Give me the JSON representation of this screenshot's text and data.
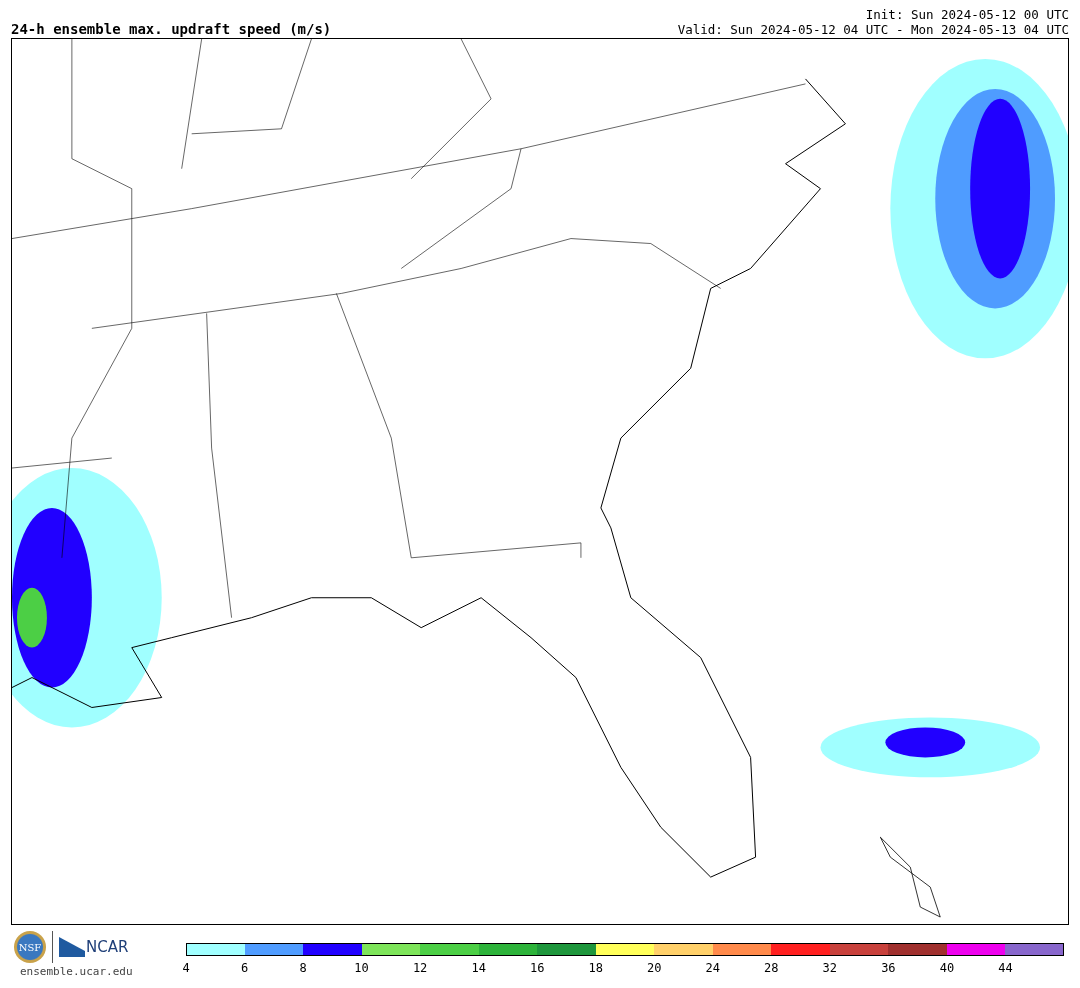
{
  "title": "24-h ensemble max. updraft speed (m/s)",
  "init": "Init: Sun 2024-05-12 00 UTC",
  "valid": "Valid: Sun 2024-05-12 04 UTC - Mon 2024-05-13 04 UTC",
  "logos": {
    "nsf": "NSF",
    "ncar": "NCAR"
  },
  "site": "ensemble.ucar.edu",
  "colorbar": [
    {
      "color": "#a0ffff",
      "label": "4"
    },
    {
      "color": "#4f9cff",
      "label": "6"
    },
    {
      "color": "#2100ff",
      "label": "8"
    },
    {
      "color": "#7ee55a",
      "label": "10"
    },
    {
      "color": "#4ccf45",
      "label": "12"
    },
    {
      "color": "#2db33a",
      "label": "14"
    },
    {
      "color": "#1e963c",
      "label": "16"
    },
    {
      "color": "#ffff5a",
      "label": "18"
    },
    {
      "color": "#ffd06a",
      "label": "20"
    },
    {
      "color": "#ff8a4b",
      "label": "24"
    },
    {
      "color": "#ff1f1f",
      "label": "28"
    },
    {
      "color": "#c8413c",
      "label": "32"
    },
    {
      "color": "#a0302e",
      "label": "36"
    },
    {
      "color": "#ee00ee",
      "label": "40"
    },
    {
      "color": "#8866cc",
      "label": "44"
    }
  ]
}
